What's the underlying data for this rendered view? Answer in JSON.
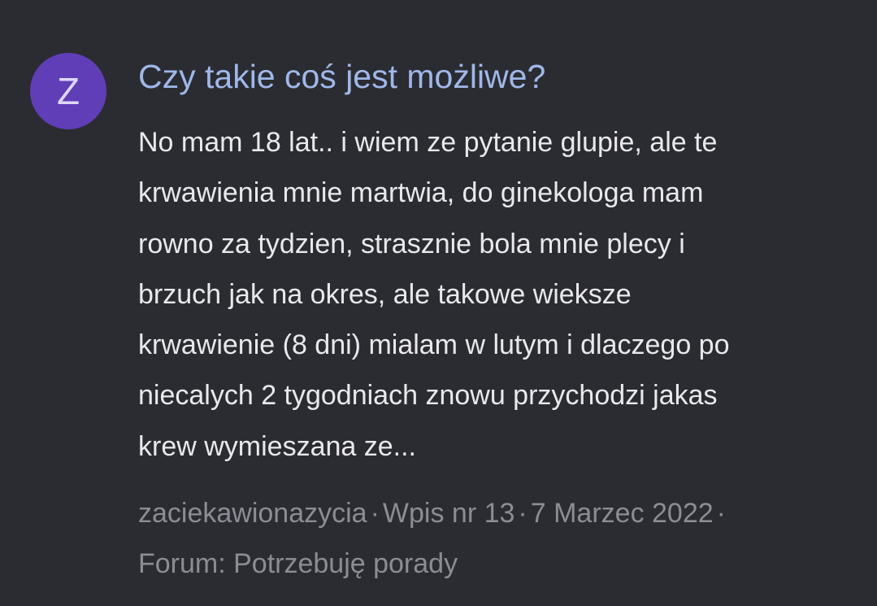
{
  "result": {
    "avatar_letter": "Z",
    "title": "Czy takie coś jest możliwe?",
    "snippet_lines": [
      "No mam 18 lat.. i wiem ze pytanie glupie, ale te",
      "krwawienia mnie martwia, do ginekologa mam",
      "rowno za tydzien, strasznie bola mnie plecy i",
      "brzuch jak na okres, ale takowe wieksze",
      "krwawienie (8 dni) mialam w lutym i dlaczego po",
      "niecalych 2 tygodniach znowu przychodzi jakas",
      "krew wymieszana ze..."
    ],
    "author": "zaciekawionazycia",
    "entry": "Wpis nr 13",
    "date": "7 Marzec 2022",
    "separator": "·",
    "forum": "Forum: Potrzebuję porady"
  },
  "colors": {
    "background": "#2b2c31",
    "avatar": "#5f3eb8",
    "title": "#9fb8ea",
    "body_text": "#e9e9ec",
    "meta_text": "#8b8d94"
  }
}
